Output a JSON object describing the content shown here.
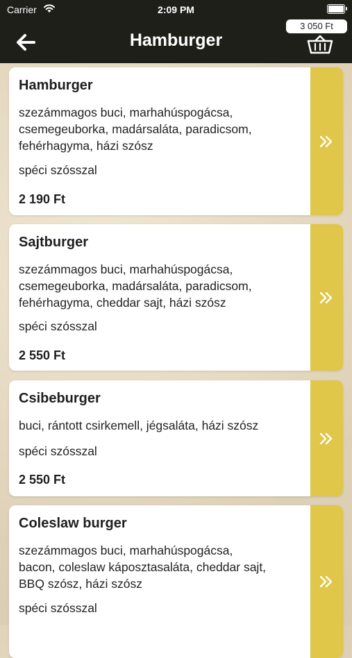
{
  "status": {
    "carrier": "Carrier",
    "time": "2:09 PM"
  },
  "header": {
    "title": "Hamburger",
    "cart_total": "3 050 Ft"
  },
  "icons": {
    "back": "arrow-left-icon",
    "cart": "basket-icon",
    "open": "double-chevron-right-icon"
  },
  "colors": {
    "topbar": "#1f1f1a",
    "accent": "#e0c649",
    "card": "#ffffff"
  },
  "items": [
    {
      "name": "Hamburger",
      "desc": [
        "szezámmagos buci, marhahúspogácsa,",
        "csemegeuborka, madársaláta, paradicsom,",
        "fehérhagyma, házi szósz"
      ],
      "note": "spéci szósszal",
      "price": "2 190 Ft"
    },
    {
      "name": "Sajtburger",
      "desc": [
        "szezámmagos buci, marhahúspogácsa,",
        "csemegeuborka, madársaláta, paradicsom,",
        "fehérhagyma, cheddar sajt, házi szósz"
      ],
      "note": "spéci szósszal",
      "price": "2 550 Ft"
    },
    {
      "name": "Csibeburger",
      "desc": [
        "buci, rántott csirkemell, jégsaláta, házi szósz"
      ],
      "note": "spéci szósszal",
      "price": "2 550 Ft"
    },
    {
      "name": "Coleslaw burger",
      "desc": [
        "szezámmagos buci, marhahúspogácsa,",
        "bacon, coleslaw káposztasaláta, cheddar sajt,",
        "BBQ szósz, házi szósz"
      ],
      "note": "spéci szósszal",
      "price": ""
    }
  ]
}
